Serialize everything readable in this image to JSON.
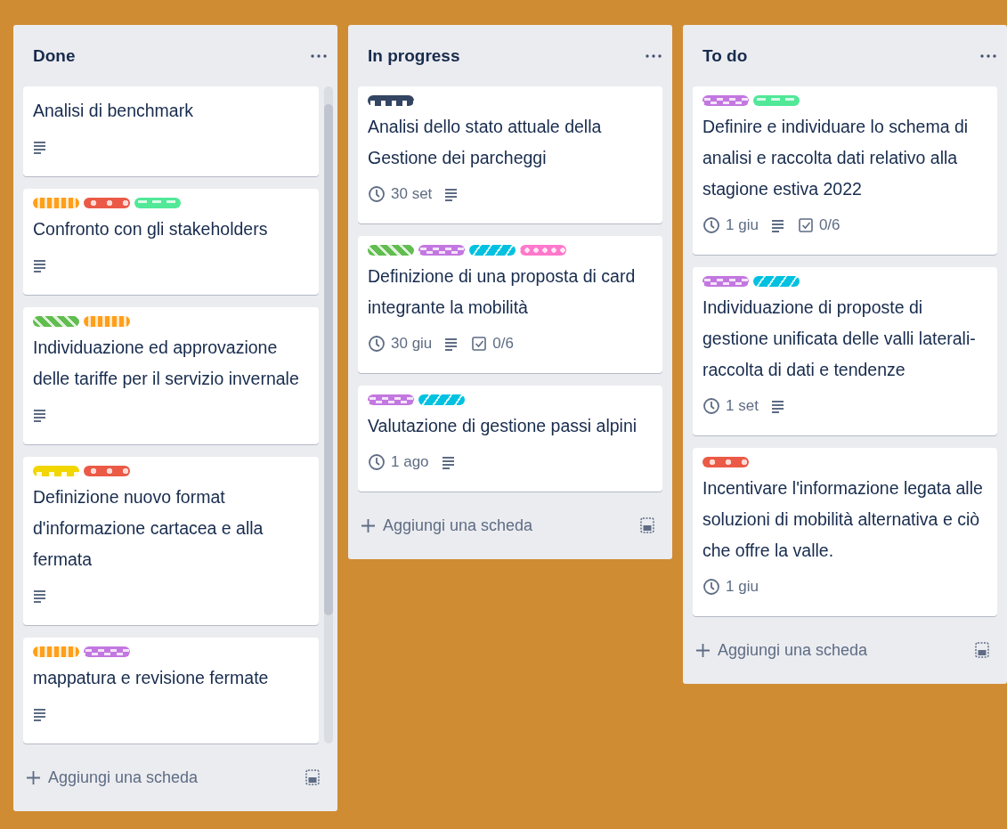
{
  "lists": [
    {
      "title": "Done",
      "scrollable": true,
      "cards": [
        {
          "title": "Analisi di benchmark",
          "badges": [
            {
              "kind": "description"
            }
          ]
        },
        {
          "title": "Confronto con gli stakeholders",
          "labels": [
            {
              "color": "#ff9f1a"
            },
            {
              "color": "#eb5a46"
            },
            {
              "color": "#51e898"
            }
          ],
          "badges": [
            {
              "kind": "description"
            }
          ]
        },
        {
          "title": "Individuazione ed approvazione delle tariffe per il servizio invernale",
          "labels": [
            {
              "color": "#61bd4f"
            },
            {
              "color": "#ff9f1a"
            }
          ],
          "badges": [
            {
              "kind": "description"
            }
          ]
        },
        {
          "title": "Definizione nuovo format d'informazione cartacea e alla fermata",
          "labels": [
            {
              "color": "#f2d600"
            },
            {
              "color": "#eb5a46"
            }
          ],
          "badges": [
            {
              "kind": "description"
            }
          ]
        },
        {
          "title": "mappatura e revisione fermate",
          "labels": [
            {
              "color": "#ff9f1a"
            },
            {
              "color": "#c377e0"
            }
          ],
          "badges": [
            {
              "kind": "description"
            }
          ]
        }
      ],
      "add_label": "Aggiungi una scheda"
    },
    {
      "title": "In progress",
      "scrollable": false,
      "cards": [
        {
          "title": "Analisi dello stato attuale della Gestione dei parcheggi",
          "labels": [
            {
              "color": "#344563"
            }
          ],
          "badges": [
            {
              "kind": "due",
              "text": "30 set"
            },
            {
              "kind": "description"
            }
          ]
        },
        {
          "title": "Definizione di una proposta di card integrante la mobilità",
          "labels": [
            {
              "color": "#61bd4f"
            },
            {
              "color": "#c377e0"
            },
            {
              "color": "#00c2e0"
            },
            {
              "color": "#ff78cb"
            }
          ],
          "badges": [
            {
              "kind": "due",
              "text": "30 giu"
            },
            {
              "kind": "description"
            },
            {
              "kind": "checklist",
              "text": "0/6"
            }
          ]
        },
        {
          "title": "Valutazione di gestione passi alpini",
          "labels": [
            {
              "color": "#c377e0"
            },
            {
              "color": "#00c2e0"
            }
          ],
          "badges": [
            {
              "kind": "due",
              "text": "1 ago"
            },
            {
              "kind": "description"
            }
          ]
        }
      ],
      "add_label": "Aggiungi una scheda"
    },
    {
      "title": "To do",
      "scrollable": false,
      "cards": [
        {
          "title": "Definire e individuare lo schema di analisi e raccolta dati relativo alla stagione estiva 2022",
          "labels": [
            {
              "color": "#c377e0"
            },
            {
              "color": "#51e898"
            }
          ],
          "badges": [
            {
              "kind": "due",
              "text": "1 giu"
            },
            {
              "kind": "description"
            },
            {
              "kind": "checklist",
              "text": "0/6"
            }
          ]
        },
        {
          "title": "Individuazione di proposte di gestione unificata delle valli laterali-raccolta di dati e tendenze",
          "labels": [
            {
              "color": "#c377e0"
            },
            {
              "color": "#00c2e0"
            }
          ],
          "badges": [
            {
              "kind": "due",
              "text": "1 set"
            },
            {
              "kind": "description"
            }
          ]
        },
        {
          "title": "Incentivare l'informazione legata alle soluzioni di mobilità alternativa e ciò che offre la valle.",
          "labels": [
            {
              "color": "#eb5a46"
            }
          ],
          "badges": [
            {
              "kind": "due",
              "text": "1 giu"
            }
          ]
        }
      ],
      "add_label": "Aggiungi una scheda"
    }
  ]
}
